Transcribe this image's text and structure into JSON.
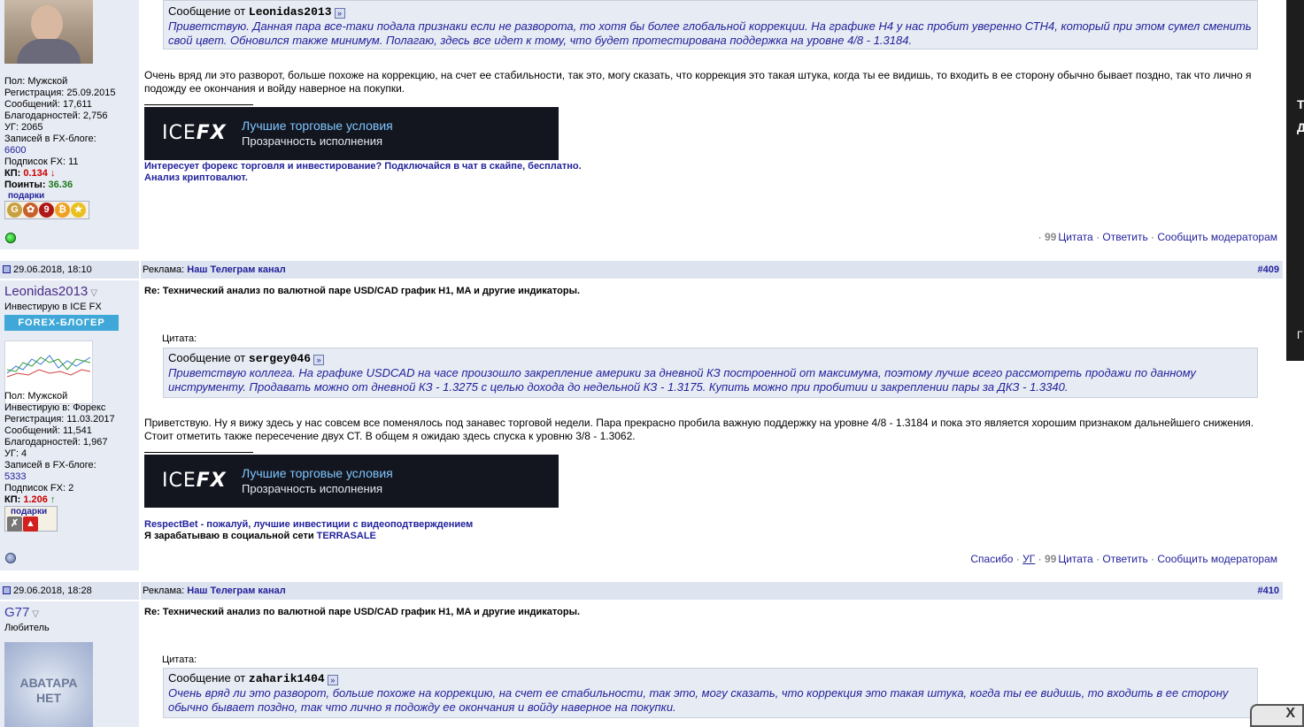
{
  "post1": {
    "user_info": {
      "gender": "Пол: Мужской",
      "registration": "Регистрация: 25.09.2015",
      "messages": "Сообщений: 17,611",
      "thanks": "Благодарностей: 2,756",
      "ug": "УГ: 2065",
      "blog_label": "Записей в FX-блоге:",
      "blog_count": "6600",
      "subs": "Подписок FX: 11",
      "kp_label": "КП:",
      "kp_value": "0.134",
      "kp_arrow": "↓",
      "points_label": "Поинты:",
      "points_value": "36.36",
      "gifts_label": "подарки"
    },
    "quote": {
      "from_prefix": "Сообщение от",
      "from_user": "Leonidas2013",
      "text": "Приветствую. Данная пара все-таки подала признаки если не разворота, то хотя бы более глобальной коррекции. На графике H4 у нас пробит уверенно СТН4, который при этом сумел сменить свой цвет. Обновился также минимум. Полагаю, здесь все идет к тому, что будет протестирована поддержка на уровне 4/8 - 1.3184."
    },
    "body": "Очень вряд ли это разворот, больше похоже на коррекцию, на счет ее стабильности, так это, могу сказать, что коррекция это такая штука, когда ты ее видишь, то входить в ее сторону обычно бывает поздно, так что лично я подожду ее окончания и войду наверное на покупки.",
    "ad": {
      "logo_a": "ICE",
      "logo_b": "FX",
      "line1": "Лучшие торговые условия",
      "line2": "Прозрачность исполнения"
    },
    "signature": {
      "line1": "Интересует форекс торговля и инвестирование? Подключайся в чат в скайпе, бесплатно.",
      "line2": "Анализ криптовалют."
    },
    "actions": {
      "sep": "·",
      "quote": "Цитата",
      "reply": "Ответить",
      "report": "Сообщить модераторам"
    }
  },
  "post2": {
    "header": {
      "date": "29.06.2018, 18:10",
      "ad_label": "Реклама:",
      "ad_link": "Наш Телеграм канал",
      "number": "#409"
    },
    "user": {
      "name": "Leonidas2013",
      "title": "Инвестирую в ICE FX",
      "badge": "FOREX-БЛОГЕР",
      "gender": "Пол: Мужской",
      "invests": "Инвестирую в: Форекс",
      "registration": "Регистрация: 11.03.2017",
      "messages": "Сообщений: 11,541",
      "thanks": "Благодарностей: 1,967",
      "ug": "УГ: 4",
      "blog_label": "Записей в FX-блоге:",
      "blog_count": "5333",
      "subs": "Подписок FX: 2",
      "kp_label": "КП:",
      "kp_value": "1.206",
      "kp_arrow": "↑",
      "gifts_label": "подарки"
    },
    "title": "Re: Технический анализ по валютной паре USD/CAD график H1, MA и другие индикаторы.",
    "quote_label": "Цитата:",
    "quote": {
      "from_prefix": "Сообщение от",
      "from_user": "sergey046",
      "text": "Приветствую коллега. На графике USDCAD на часе произошло закрепление америки за дневной КЗ построенной от максимума, поэтому лучше всего рассмотреть продажи по данному инструменту. Продавать можно от дневной КЗ - 1.3275 с целью дохода до недельной КЗ - 1.3175. Купить можно при пробитии и закреплении пары за ДКЗ - 1.3340."
    },
    "body": "Приветствую. Ну я вижу здесь у нас совсем все поменялось под занавес торговой недели. Пара прекрасно пробила важную поддержку на уровне 4/8 - 1.3184 и пока это является хорошим признаком дальнейшего снижения. Стоит отметить также пересечение двух СТ. В общем я ожидаю здесь спуска к уровню 3/8 - 1.3062.",
    "ad": {
      "logo_a": "ICE",
      "logo_b": "FX",
      "line1": "Лучшие торговые условия",
      "line2": "Прозрачность исполнения"
    },
    "signature": {
      "line1": "RespectBet - пожалуй, лучшие инвестиции с видеоподтверждением",
      "line2_prefix": "Я зарабатываю в социальной сети",
      "line2_link": "TERRASALE"
    },
    "actions": {
      "thanks": "Спасибо",
      "sep": "·",
      "ug": "УГ",
      "quote": "Цитата",
      "reply": "Ответить",
      "report": "Сообщить модераторам"
    }
  },
  "post3": {
    "header": {
      "date": "29.06.2018, 18:28",
      "ad_label": "Реклама:",
      "ad_link": "Наш Телеграм канал",
      "number": "#410"
    },
    "user": {
      "name": "G77",
      "title": "Любитель",
      "avatar_line1": "АВАТАРА",
      "avatar_line2": "НЕТ"
    },
    "title": "Re: Технический анализ по валютной паре USD/CAD график H1, MA и другие индикаторы.",
    "quote_label": "Цитата:",
    "quote": {
      "from_prefix": "Сообщение от",
      "from_user": "zaharik1404",
      "text": "Очень вряд ли это разворот, больше похоже на коррекцию, на счет ее стабильности, так это, могу сказать, что коррекция это такая штука, когда ты ее видишь, то входить в ее сторону обычно бывает поздно, так что лично я подожду ее окончания и войду наверное на покупки."
    }
  },
  "right_strip": {
    "c1": "Т",
    "c2": "Д",
    "c3": "Г"
  },
  "corner_glyph": "X",
  "colors": {
    "link": "#22229c",
    "user_bg": "#e7ebf3",
    "header_bg": "#dde3ef",
    "ad_bg": "#14161f",
    "badge": "#3fa8d8"
  }
}
